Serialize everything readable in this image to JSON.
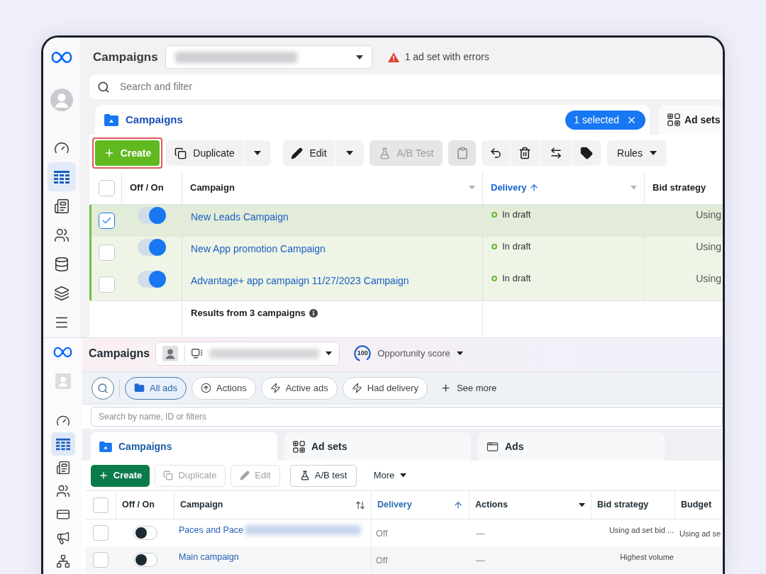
{
  "classic_view": {
    "header": {
      "title": "Campaigns",
      "warning": "1 ad set with errors"
    },
    "sidebar": {
      "items": [
        {
          "selected": false
        },
        {
          "selected": true
        },
        {
          "selected": false
        },
        {
          "selected": false
        },
        {
          "selected": false
        },
        {
          "selected": false
        },
        {
          "selected": false
        }
      ]
    },
    "search": {
      "placeholder": "Search and filter"
    },
    "tabs": [
      {
        "label": "Campaigns",
        "selected": true
      },
      {
        "label": "Ad sets",
        "selected": false
      }
    ],
    "selection_badge": "1 selected",
    "toolbar": {
      "create": {
        "label": "Create",
        "highlighted": true
      },
      "buttons": [
        {
          "kind": "split",
          "label": "Duplicate",
          "disabled": false
        },
        {
          "kind": "split",
          "label": "Edit",
          "disabled": false
        },
        {
          "kind": "plain",
          "label": "A/B Test",
          "disabled": true
        }
      ],
      "icon_buttons": [
        {
          "disabled": true
        },
        {
          "disabled": false
        },
        {
          "disabled": false
        },
        {
          "disabled": false
        },
        {
          "disabled": false
        }
      ],
      "menu": "Rules"
    },
    "table": {
      "select_all_checked": false,
      "columns": [
        {
          "label": "Off / On",
          "sorted": false,
          "menu": false
        },
        {
          "label": "Campaign",
          "sorted": false,
          "menu": true
        },
        {
          "label": "Delivery",
          "sorted": true,
          "menu": true
        },
        {
          "label": "Bid strategy",
          "sorted": false,
          "menu": false
        }
      ],
      "rows": [
        {
          "selected": true,
          "on": true,
          "campaign": "New Leads Campaign",
          "delivery": "In draft",
          "bid_strategy": "Using"
        },
        {
          "selected": false,
          "on": true,
          "campaign": "New App promotion Campaign",
          "delivery": "In draft",
          "bid_strategy": "Using"
        },
        {
          "selected": false,
          "on": true,
          "campaign": "Advantage+ app campaign 11/27/2023 Campaign",
          "delivery": "In draft",
          "bid_strategy": "Using"
        }
      ],
      "footer": "Results from 3 campaigns"
    }
  },
  "new_view": {
    "header": {
      "title": "Campaigns",
      "score": "100",
      "score_label": "Opportunity score"
    },
    "sidebar": {
      "items": [
        {
          "selected": false
        },
        {
          "selected": true
        },
        {
          "selected": false
        },
        {
          "selected": false
        },
        {
          "selected": false
        },
        {
          "selected": false
        },
        {
          "selected": false
        }
      ]
    },
    "filters": {
      "items": [
        {
          "label": "All ads",
          "selected": true
        },
        {
          "label": "Actions",
          "selected": false
        },
        {
          "label": "Active ads",
          "selected": false
        },
        {
          "label": "Had delivery",
          "selected": false
        }
      ],
      "see_more": "See more"
    },
    "search": {
      "placeholder": "Search by name, ID or filters"
    },
    "tabs": [
      {
        "label": "Campaigns",
        "selected": true
      },
      {
        "label": "Ad sets",
        "selected": false
      },
      {
        "label": "Ads",
        "selected": false
      }
    ],
    "toolbar": {
      "create": {
        "label": "Create"
      },
      "buttons": [
        {
          "label": "Duplicate",
          "disabled": true
        },
        {
          "label": "Edit",
          "disabled": true
        },
        {
          "label": "A/B test",
          "disabled": false
        }
      ],
      "menu": "More"
    },
    "table": {
      "select_all_checked": false,
      "columns": [
        {
          "label": "Off / On",
          "sorted": false,
          "sortable": false,
          "menu": false
        },
        {
          "label": "Campaign",
          "sorted": false,
          "sortable": true,
          "menu": false
        },
        {
          "label": "Delivery",
          "sorted": true,
          "sortable": false,
          "menu": false
        },
        {
          "label": "Actions",
          "sorted": false,
          "sortable": false,
          "menu": true
        },
        {
          "label": "Bid strategy",
          "sorted": false,
          "sortable": false,
          "menu": false
        },
        {
          "label": "Budget",
          "sorted": false,
          "sortable": false,
          "menu": false
        }
      ],
      "rows": [
        {
          "selected": false,
          "on": false,
          "campaign": "Paces and Pace",
          "redacted": true,
          "delivery": "Off",
          "actions": "—",
          "bid_strategy": "Using ad set bid ...",
          "budget": "Using ad se"
        },
        {
          "selected": false,
          "on": false,
          "campaign": "Main campaign",
          "redacted": false,
          "delivery": "Off",
          "actions": "—",
          "bid_strategy": "Highest volume"
        }
      ]
    }
  }
}
